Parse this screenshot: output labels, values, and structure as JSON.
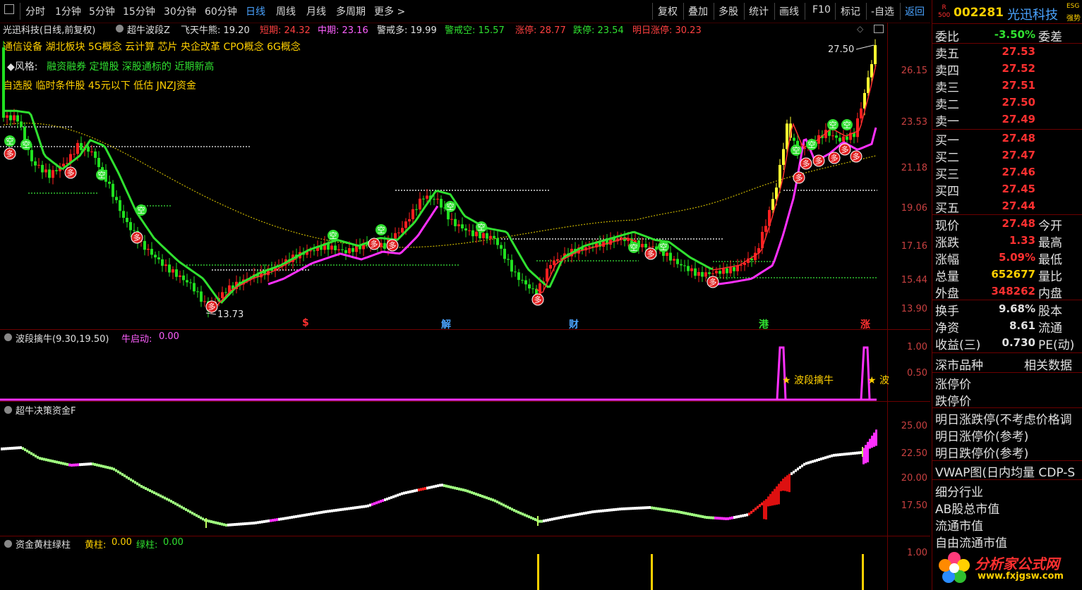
{
  "toolbar": {
    "left_items": [
      "分时",
      "1分钟",
      "5分钟",
      "15分钟",
      "30分钟",
      "60分钟",
      "日线",
      "周线",
      "月线",
      "多周期",
      "更多 >"
    ],
    "active": "日线",
    "right_items": [
      "复权",
      "叠加",
      "多股",
      "统计",
      "画线",
      "F10",
      "标记",
      "-自选",
      "返回"
    ]
  },
  "main": {
    "stock_title": "光迅科技(日线,前复权)",
    "indicator_name": "超牛波段Z",
    "metrics": [
      {
        "label": "飞天牛熊:",
        "value": "19.20",
        "color": "#e0e0e0"
      },
      {
        "label": "短期:",
        "value": "24.32",
        "color": "#ff4040"
      },
      {
        "label": "中期:",
        "value": "23.16",
        "color": "#ff60ff"
      },
      {
        "label": "警戒多:",
        "value": "19.99",
        "color": "#e0e0e0"
      },
      {
        "label": "警戒空:",
        "value": "15.57",
        "color": "#30e030"
      },
      {
        "label": "涨停:",
        "value": "28.77",
        "color": "#ff4040"
      },
      {
        "label": "跌停:",
        "value": "23.54",
        "color": "#30e030"
      },
      {
        "label": "明日涨停:",
        "value": "30.23",
        "color": "#ff4040"
      }
    ],
    "concepts": "通信设备 湖北板块 5G概念 云计算 芯片 央企改革 CPO概念 6G概念",
    "style_label": "◆风格:",
    "style_value": "融资融券 定增股 深股通标的 近期新高",
    "tags": "自选股 临时条件股 45元以下 低估 JNZJ资金",
    "high_label": "27.50",
    "low_label": "13.73",
    "y_ticks": [
      "26.15",
      "23.53",
      "21.18",
      "19.06",
      "17.16",
      "15.44",
      "13.90"
    ],
    "event_markers": [
      {
        "text": "$",
        "color": "#ff3030"
      },
      {
        "text": "解",
        "color": "#4aa3ff"
      },
      {
        "text": "财",
        "color": "#4aa3ff"
      },
      {
        "text": "港",
        "color": "#30e030"
      },
      {
        "text": "涨",
        "color": "#ff3030"
      }
    ],
    "kong": "空",
    "duo": "多"
  },
  "panel2": {
    "title": "波段擒牛(9.30,19.50)",
    "metric_label": "牛启动:",
    "metric_value": "0.00",
    "y_ticks": [
      "1.00",
      "0.50"
    ],
    "signal_label": "★ 波段擒牛",
    "signal_label2": "★ 波"
  },
  "panel3": {
    "title": "超牛决策资金F",
    "y_ticks": [
      "25.00",
      "22.50",
      "20.00",
      "17.50"
    ]
  },
  "panel4": {
    "title": "资金黄柱绿柱",
    "yellow_label": "黄柱:",
    "yellow_value": "0.00",
    "green_label": "绿柱:",
    "green_value": "0.00",
    "y_ticks": [
      "1.00"
    ]
  },
  "right": {
    "badge_top": "R",
    "badge_bottom": "500",
    "code": "002281",
    "name": "光迅科技",
    "small_tag": "强势",
    "small_tag2": "ESG",
    "weibi_label": "委比",
    "weibi_value": "-3.50%",
    "weicha_label": "委差",
    "asks": [
      {
        "label": "卖五",
        "price": "27.53"
      },
      {
        "label": "卖四",
        "price": "27.52"
      },
      {
        "label": "卖三",
        "price": "27.51"
      },
      {
        "label": "卖二",
        "price": "27.50"
      },
      {
        "label": "卖一",
        "price": "27.49"
      }
    ],
    "bids": [
      {
        "label": "买一",
        "price": "27.48"
      },
      {
        "label": "买二",
        "price": "27.47"
      },
      {
        "label": "买三",
        "price": "27.46"
      },
      {
        "label": "买四",
        "price": "27.45"
      },
      {
        "label": "买五",
        "price": "27.44"
      }
    ],
    "quote": [
      {
        "label": "现价",
        "value": "27.48",
        "color": "#ff3030",
        "label2": "今开"
      },
      {
        "label": "涨跌",
        "value": "1.33",
        "color": "#ff3030",
        "label2": "最高"
      },
      {
        "label": "涨幅",
        "value": "5.09%",
        "color": "#ff3030",
        "label2": "最低"
      },
      {
        "label": "总量",
        "value": "652677",
        "color": "#ffd000",
        "label2": "量比"
      },
      {
        "label": "外盘",
        "value": "348262",
        "color": "#ff3030",
        "label2": "内盘"
      }
    ],
    "quote2": [
      {
        "label": "换手",
        "value": "9.68%",
        "color": "#e0e0e0",
        "label2": "股本"
      },
      {
        "label": "净资",
        "value": "8.61",
        "color": "#e0e0e0",
        "label2": "流通"
      },
      {
        "label": "收益(三)",
        "value": "0.730",
        "color": "#e0e0e0",
        "label2": "PE(动)"
      }
    ],
    "market_label": "深市品种",
    "related_label": "相关数据",
    "limit_up": "涨停价",
    "limit_down": "跌停价",
    "info_lines": [
      "明日涨跌停(不考虑价格调",
      "明日涨停价(参考)",
      "明日跌停价(参考)"
    ],
    "vwap_line": "VWAP图(日内均量 CDP-S",
    "info_lines2": [
      "细分行业",
      "AB股总市值",
      "流通市值",
      "自由流通市值"
    ],
    "watermark_cn": "分析家公式网",
    "watermark_url": "www.fxjgsw.com"
  }
}
